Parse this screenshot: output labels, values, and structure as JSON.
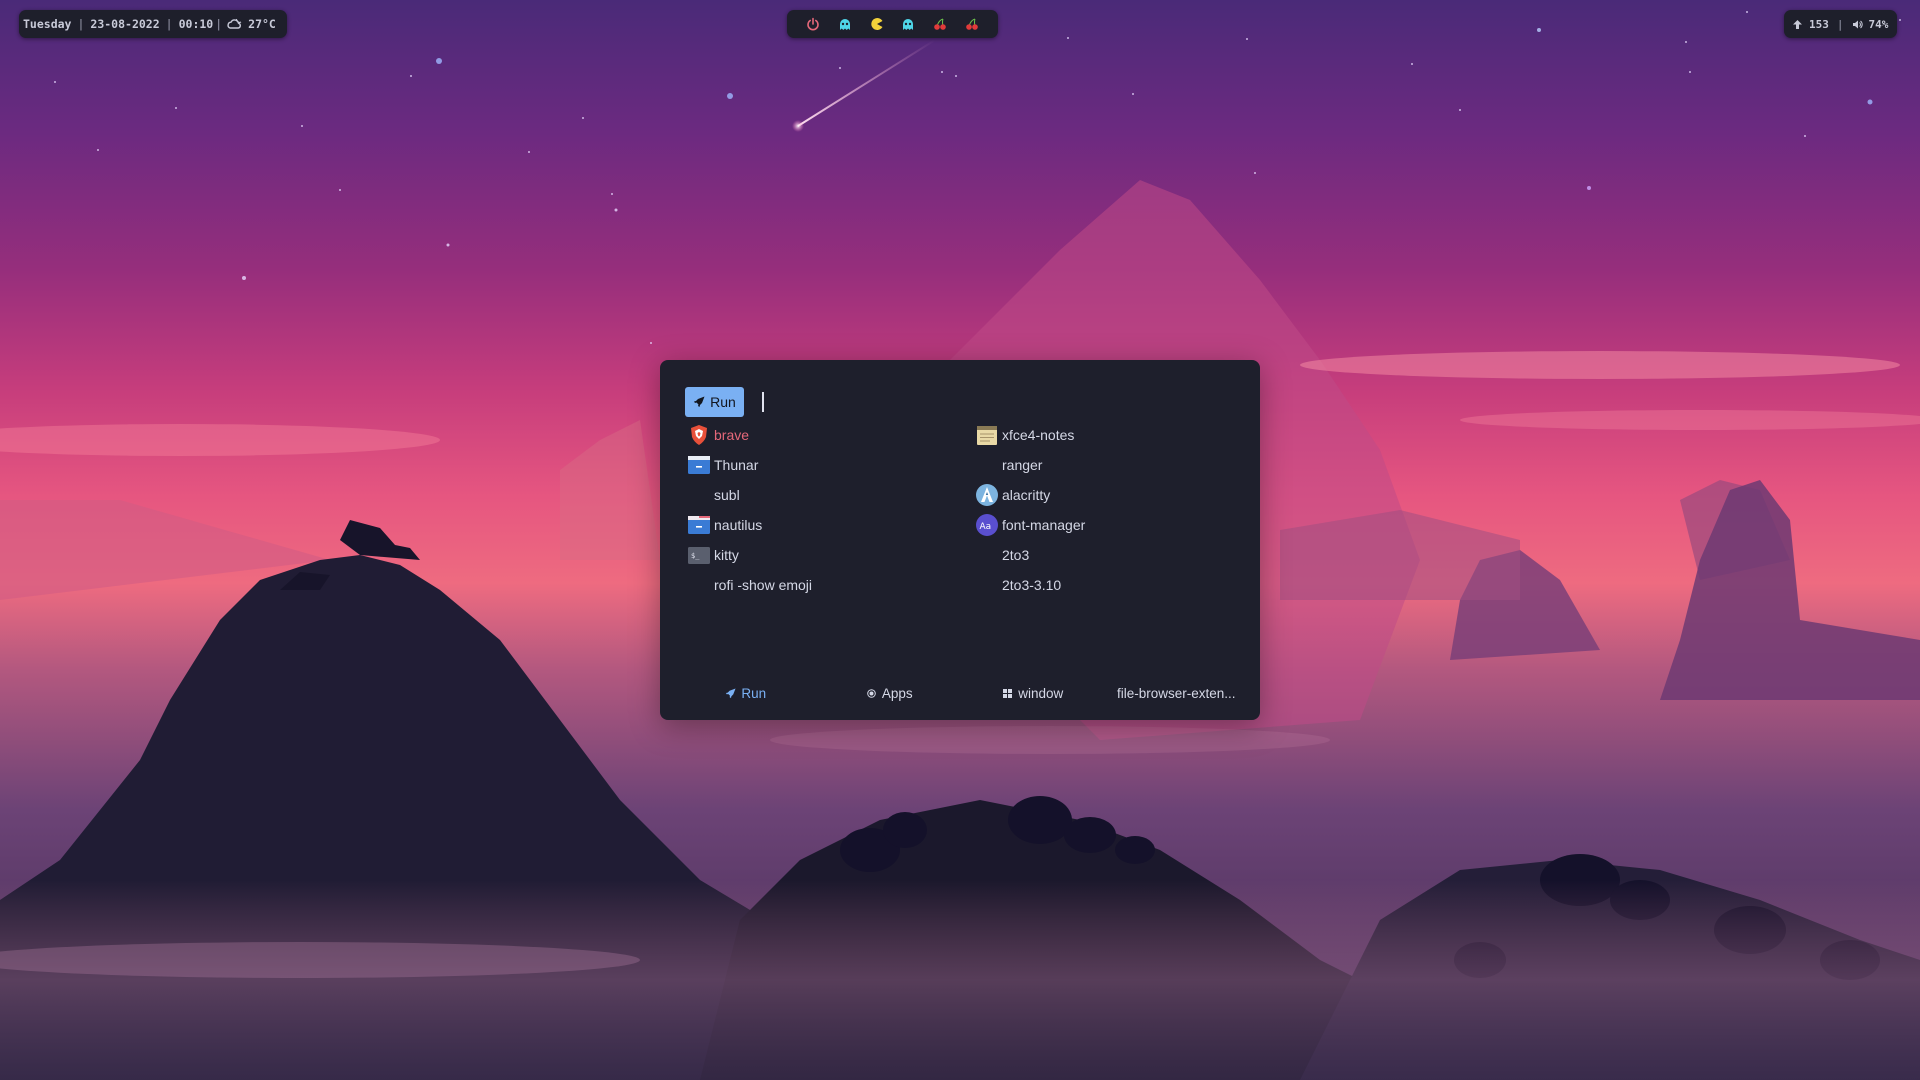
{
  "topbar": {
    "day": "Tuesday",
    "date": "23-08-2022",
    "time": "00:10",
    "temperature": "27°C",
    "updates": "153",
    "volume": "74%",
    "workspace_icons": [
      "power-icon",
      "ghost-icon",
      "pacman-icon",
      "ghost-icon",
      "cherry-icon",
      "cherry-icon"
    ]
  },
  "launcher": {
    "prompt_label": "Run",
    "input_value": "",
    "entries_left": [
      {
        "label": "brave",
        "icon": "brave-icon"
      },
      {
        "label": "Thunar",
        "icon": "folder-icon"
      },
      {
        "label": "subl",
        "icon": ""
      },
      {
        "label": "nautilus",
        "icon": "folder-icon"
      },
      {
        "label": "kitty",
        "icon": "terminal-icon"
      },
      {
        "label": "rofi -show emoji",
        "icon": ""
      }
    ],
    "entries_right": [
      {
        "label": "xfce4-notes",
        "icon": "notes-icon"
      },
      {
        "label": "ranger",
        "icon": ""
      },
      {
        "label": "alacritty",
        "icon": "alacritty-icon"
      },
      {
        "label": "font-manager",
        "icon": "font-manager-icon"
      },
      {
        "label": "2to3",
        "icon": ""
      },
      {
        "label": "2to3-3.10",
        "icon": ""
      }
    ],
    "modes": [
      "Run",
      "Apps",
      "window",
      "file-browser-exten..."
    ]
  },
  "colors": {
    "accent": "#7ab0f3",
    "selected_text": "#e5687a",
    "panel_bg": "#1e1f2c",
    "text": "#d5d8e6"
  }
}
